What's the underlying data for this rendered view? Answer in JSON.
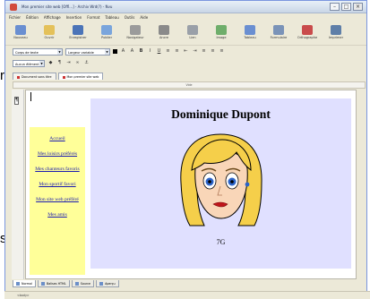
{
  "window": {
    "title": "Mon premier site web [Offl...] - Archiv Wrd(?) - Nvu"
  },
  "side_letters": {
    "top": "r",
    "bottom": "s"
  },
  "menu": [
    "Fichier",
    "Édition",
    "Affichage",
    "Insertion",
    "Format",
    "Tableau",
    "Outils",
    "Aide"
  ],
  "toolbar": [
    {
      "label": "Nouveau",
      "icon": "new-page-icon",
      "color": "#6a8fd1"
    },
    {
      "label": "Ouvrir",
      "icon": "open-folder-icon",
      "color": "#e4c15a"
    },
    {
      "label": "Enregistrer",
      "icon": "save-icon",
      "color": "#4b74b8"
    },
    {
      "label": "Publier",
      "icon": "publish-icon",
      "color": "#7aa5dc"
    },
    {
      "label": "Navigateur",
      "icon": "browser-icon",
      "color": "#9b9b9b"
    },
    {
      "label": "Ancre",
      "icon": "anchor-icon",
      "color": "#8a8a8a"
    },
    {
      "label": "Lien",
      "icon": "link-icon",
      "color": "#9aa0a8"
    },
    {
      "label": "Image",
      "icon": "image-icon",
      "color": "#6fae6b"
    },
    {
      "label": "Tableau",
      "icon": "table-icon",
      "color": "#6a8fd1"
    },
    {
      "label": "Formulaire",
      "icon": "form-icon",
      "color": "#7a93b8"
    },
    {
      "label": "Orthographe",
      "icon": "spellcheck-icon",
      "color": "#c94b4b"
    },
    {
      "label": "Imprimer",
      "icon": "print-icon",
      "color": "#5f7fa8"
    }
  ],
  "format": {
    "style_select": "Corps de texte",
    "font_select": "Largeur variable",
    "class_select": "Aucun élément"
  },
  "document_tabs": [
    {
      "label": "Document sans titre",
      "active": false
    },
    {
      "label": "Mon premier site web",
      "active": true
    }
  ],
  "ruler_text": "Vide",
  "page": {
    "nav_links": [
      "Accueil",
      "Mes loisirs préférés",
      "Mes chanteurs favoris",
      "Mon sportif favori",
      "Mon site web préféré",
      "Mes amis"
    ],
    "heading": "Dominique Dupont",
    "class_label": "7G",
    "colors": {
      "nav_bg": "#ffff99",
      "content_bg": "#e0e0ff",
      "link": "#1b1bb0",
      "hair": "#f5cf4a",
      "eyes": "#2b63c8",
      "lips": "#c0161b"
    }
  },
  "bottom_tabs": [
    {
      "label": "Normal",
      "active": true
    },
    {
      "label": "Balises HTML",
      "active": false
    },
    {
      "label": "Source",
      "active": false
    },
    {
      "label": "Aperçu",
      "active": false
    }
  ],
  "status_text": "<body>"
}
